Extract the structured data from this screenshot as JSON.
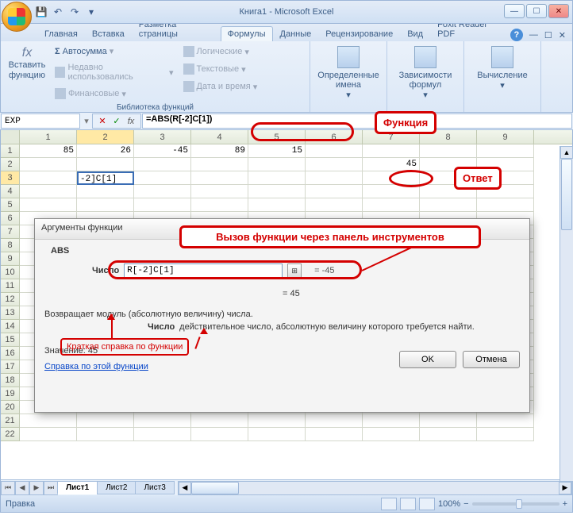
{
  "window": {
    "title": "Книга1 - Microsoft Excel"
  },
  "tabs": {
    "items": [
      "Главная",
      "Вставка",
      "Разметка страницы",
      "Формулы",
      "Данные",
      "Рецензирование",
      "Вид",
      "Foxit Reader PDF"
    ],
    "active_index": 3
  },
  "ribbon": {
    "insert_fn_top": "fx",
    "insert_fn_label": "Вставить функцию",
    "lib_group_label": "Библиотека функций",
    "lib_col1": [
      "Автосумма",
      "Недавно использовались",
      "Финансовые"
    ],
    "lib_col2": [
      "Логические",
      "Текстовые",
      "Дата и время"
    ],
    "defined_names": "Определенные имена",
    "formula_deps": "Зависимости формул",
    "calculation": "Вычисление"
  },
  "formula_bar": {
    "name_box": "EXP",
    "formula": "=ABS(R[-2]C[1])"
  },
  "columns": [
    "1",
    "2",
    "3",
    "4",
    "5",
    "6",
    "7",
    "8",
    "9"
  ],
  "active_col_index": 1,
  "rows": [
    "1",
    "2",
    "3",
    "4",
    "5",
    "6",
    "7",
    "8",
    "9",
    "10",
    "11",
    "12",
    "13",
    "14",
    "15",
    "16",
    "17",
    "18",
    "19",
    "20",
    "21",
    "22"
  ],
  "active_row_index": 2,
  "grid": {
    "r1": [
      "85",
      "26",
      "-45",
      "89",
      "15",
      "",
      "",
      "",
      ""
    ],
    "r2": [
      "",
      "",
      "",
      "",
      "",
      "",
      "45",
      "",
      ""
    ],
    "r3_editing": "-2]C[1]"
  },
  "dialog": {
    "title": "Аргументы функции",
    "fn": "ABS",
    "arg_label": "Число",
    "arg_value": "R[-2]C[1]",
    "arg_result": "= -45",
    "result_line": "=  45",
    "description": "Возвращает модуль (абсолютную величину) числа.",
    "arg_name": "Число",
    "arg_desc": "действительное число, абсолютную величину которого требуется найти.",
    "value_label": "Значение:",
    "value": "45",
    "help_link": "Справка по этой функции",
    "ok": "OK",
    "cancel": "Отмена"
  },
  "annotations": {
    "function": "Функция",
    "answer": "Ответ",
    "call_via_toolbar": "Вызов функции через панель инструментов",
    "brief_help": "Краткая справка по функции"
  },
  "sheets": {
    "items": [
      "Лист1",
      "Лист2",
      "Лист3"
    ],
    "active_index": 0
  },
  "status": {
    "left": "Правка",
    "zoom": "100%",
    "minus": "−",
    "plus": "+"
  }
}
